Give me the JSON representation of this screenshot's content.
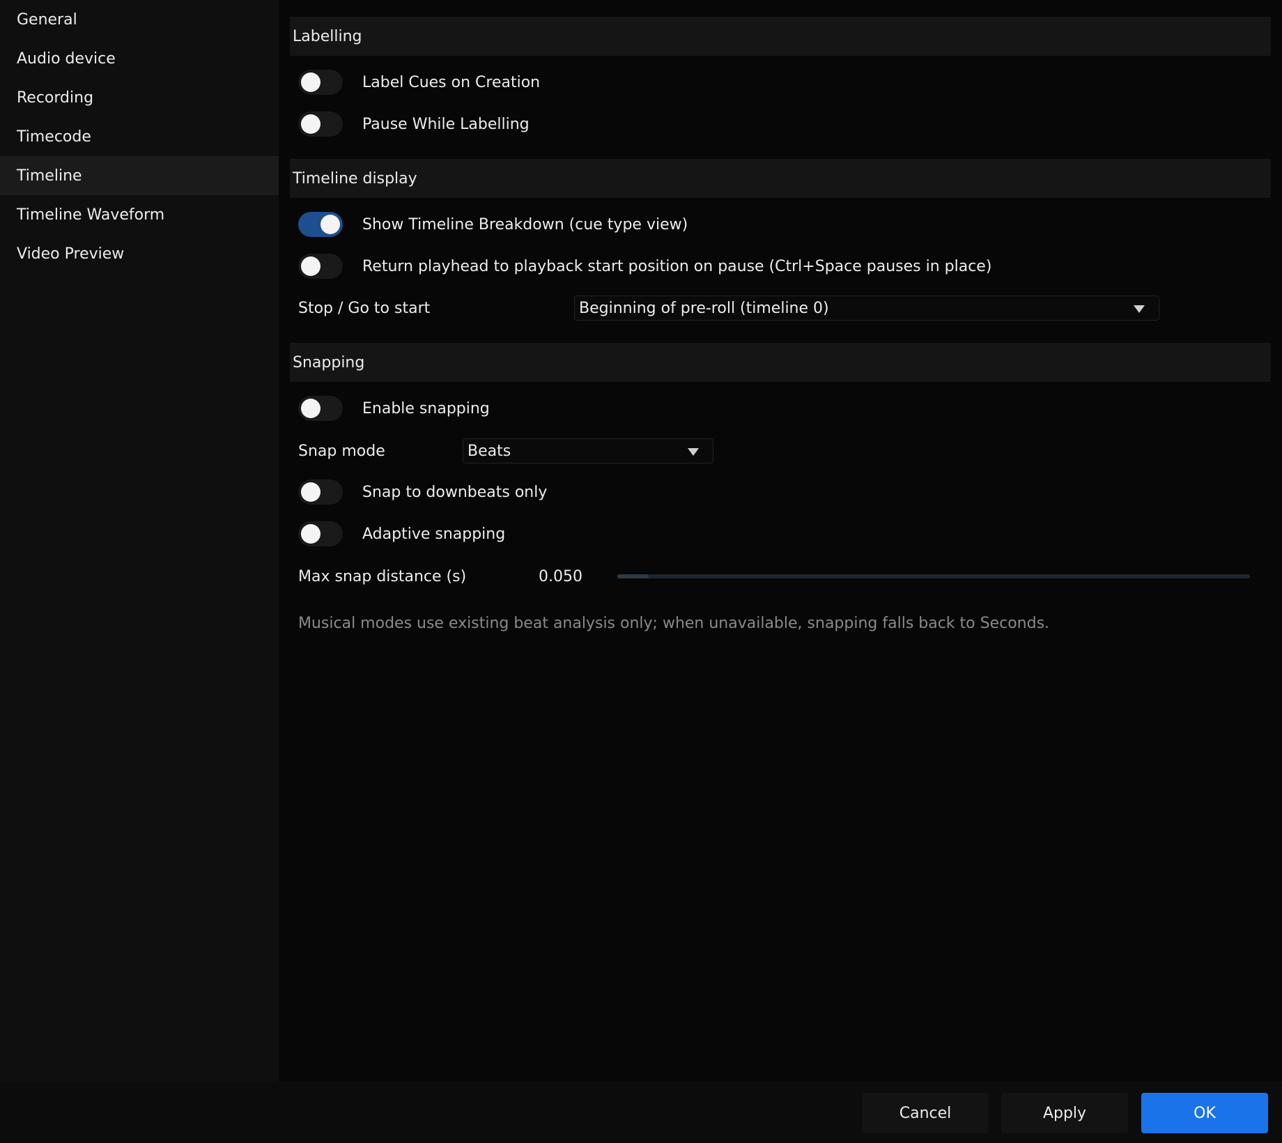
{
  "sidebar": {
    "items": [
      {
        "label": "General"
      },
      {
        "label": "Audio device"
      },
      {
        "label": "Recording"
      },
      {
        "label": "Timecode"
      },
      {
        "label": "Timeline",
        "active": true
      },
      {
        "label": "Timeline Waveform"
      },
      {
        "label": "Video Preview"
      }
    ]
  },
  "labelling": {
    "title": "Labelling",
    "label_cues_on_creation": {
      "label": "Label Cues on Creation",
      "on": false
    },
    "pause_while_labelling": {
      "label": "Pause While Labelling",
      "on": false
    }
  },
  "timeline_display": {
    "title": "Timeline display",
    "show_breakdown": {
      "label": "Show Timeline Breakdown (cue type view)",
      "on": true
    },
    "return_playhead": {
      "label": "Return playhead to playback start position on pause (Ctrl+Space pauses in place)",
      "on": false
    },
    "stop_go_to_start": {
      "label": "Stop / Go to start",
      "value": "Beginning of pre-roll (timeline 0)"
    }
  },
  "snapping": {
    "title": "Snapping",
    "enable_snapping": {
      "label": "Enable snapping",
      "on": false
    },
    "snap_mode": {
      "label": "Snap mode",
      "value": "Beats"
    },
    "downbeats_only": {
      "label": "Snap to downbeats only",
      "on": false
    },
    "adaptive": {
      "label": "Adaptive snapping",
      "on": false
    },
    "max_distance": {
      "label": "Max snap distance (s)",
      "value": "0.050",
      "fraction": 0.05
    },
    "hint": "Musical modes use existing beat analysis only; when unavailable, snapping falls back to Seconds."
  },
  "footer": {
    "cancel": "Cancel",
    "apply": "Apply",
    "ok": "OK"
  },
  "colors": {
    "accent": "#1a73e8",
    "toggle_on": "#1e4e8f"
  }
}
